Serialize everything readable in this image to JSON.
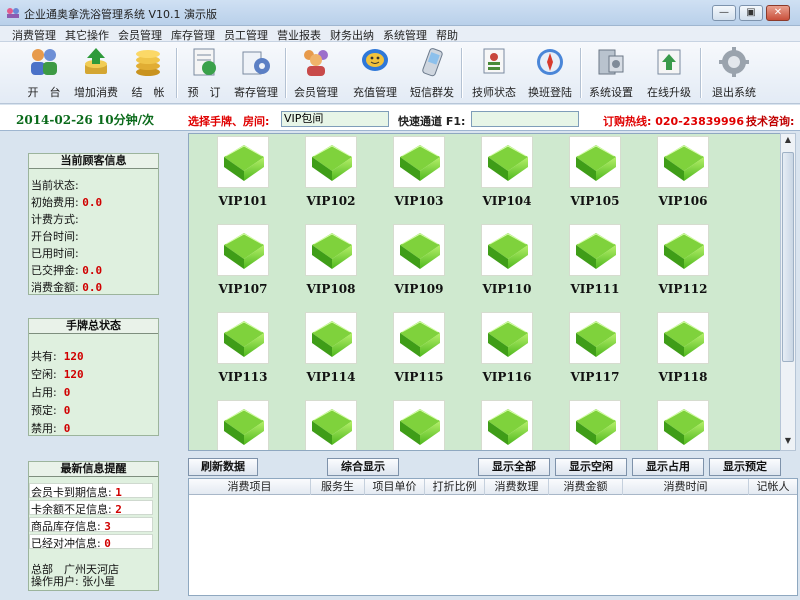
{
  "window": {
    "title": "企业通奥拿洗浴管理系统 V10.1  演示版",
    "buttons": {
      "minimize": "—",
      "maximize": "▣",
      "close": "✕"
    }
  },
  "menu": [
    "消费管理",
    "其它操作",
    "会员管理",
    "库存管理",
    "员工管理",
    "营业报表",
    "财务出纳",
    "系统管理",
    "帮助"
  ],
  "toolbar": [
    {
      "label": "开　台",
      "icon": "customers-icon"
    },
    {
      "label": "增加消费",
      "icon": "add-consumption-icon"
    },
    {
      "label": "结　帐",
      "icon": "checkout-coins-icon"
    },
    {
      "label": "预　订",
      "icon": "booking-icon"
    },
    {
      "label": "寄存管理",
      "icon": "storage-gear-icon"
    },
    {
      "label": "会员管理",
      "icon": "members-icon"
    },
    {
      "label": "充值管理",
      "icon": "chat-bubble-icon"
    },
    {
      "label": "短信群发",
      "icon": "mobile-phone-icon"
    },
    {
      "label": "技师状态",
      "icon": "technician-status-icon"
    },
    {
      "label": "换班登陆",
      "icon": "shift-login-compass-icon"
    },
    {
      "label": "系统设置",
      "icon": "system-settings-icon"
    },
    {
      "label": "在线升级",
      "icon": "online-upgrade-icon"
    },
    {
      "label": "退出系统",
      "icon": "exit-gear-icon"
    }
  ],
  "infobar": {
    "datetime": "2014-02-26  10分钟/次",
    "select_label": "选择手牌、房间:",
    "select_value": "VIP包间",
    "quick_label": "快速通道 F1:",
    "quick_value": "",
    "hotline": "订购热线: 020-23839996",
    "tech_label": "技术咨询:"
  },
  "consumer_panel": {
    "title": "当前顾客信息",
    "rows": [
      {
        "label": "当前状态:",
        "value": ""
      },
      {
        "label": "初始费用:",
        "value": "0.0"
      },
      {
        "label": "计费方式:",
        "value": ""
      },
      {
        "label": "开台时间:",
        "value": ""
      },
      {
        "label": "已用时间:",
        "value": ""
      },
      {
        "label": "已交押金:",
        "value": "0.0"
      },
      {
        "label": "消费金额:",
        "value": "0.0"
      }
    ]
  },
  "tag_panel": {
    "title": "手牌总状态",
    "rows": [
      {
        "label": "共有:",
        "value": "120"
      },
      {
        "label": "空闲:",
        "value": "120"
      },
      {
        "label": "占用:",
        "value": "0"
      },
      {
        "label": "预定:",
        "value": "0"
      },
      {
        "label": "禁用:",
        "value": "0"
      }
    ]
  },
  "notice_panel": {
    "title": "最新信息提醒",
    "rows": [
      {
        "label": "会员卡到期信息:",
        "value": "1"
      },
      {
        "label": "卡余额不足信息:",
        "value": "2"
      },
      {
        "label": "商品库存信息:",
        "value": "3"
      },
      {
        "label": "已经对冲信息:",
        "value": "0"
      }
    ],
    "footer_store": "总部　广州天河店",
    "footer_user": "操作用户: 张小星"
  },
  "rooms": [
    "VIP101",
    "VIP102",
    "VIP103",
    "VIP104",
    "VIP105",
    "VIP106",
    "VIP107",
    "VIP108",
    "VIP109",
    "VIP110",
    "VIP111",
    "VIP112",
    "VIP113",
    "VIP114",
    "VIP115",
    "VIP116",
    "VIP117",
    "VIP118",
    "",
    "",
    "",
    "",
    "",
    ""
  ],
  "actions": [
    "刷新数据",
    "综合显示",
    "显示全部",
    "显示空闲",
    "显示占用",
    "显示预定"
  ],
  "table": {
    "columns": [
      "消费项目",
      "服务生",
      "项目单价",
      "打折比例",
      "消费数理",
      "消费金额",
      "消费时间",
      "记帐人"
    ]
  },
  "colors": {
    "accent_green": "#2f8f0a",
    "alert_red": "#e00000",
    "panel_bg": "#dff0df"
  }
}
